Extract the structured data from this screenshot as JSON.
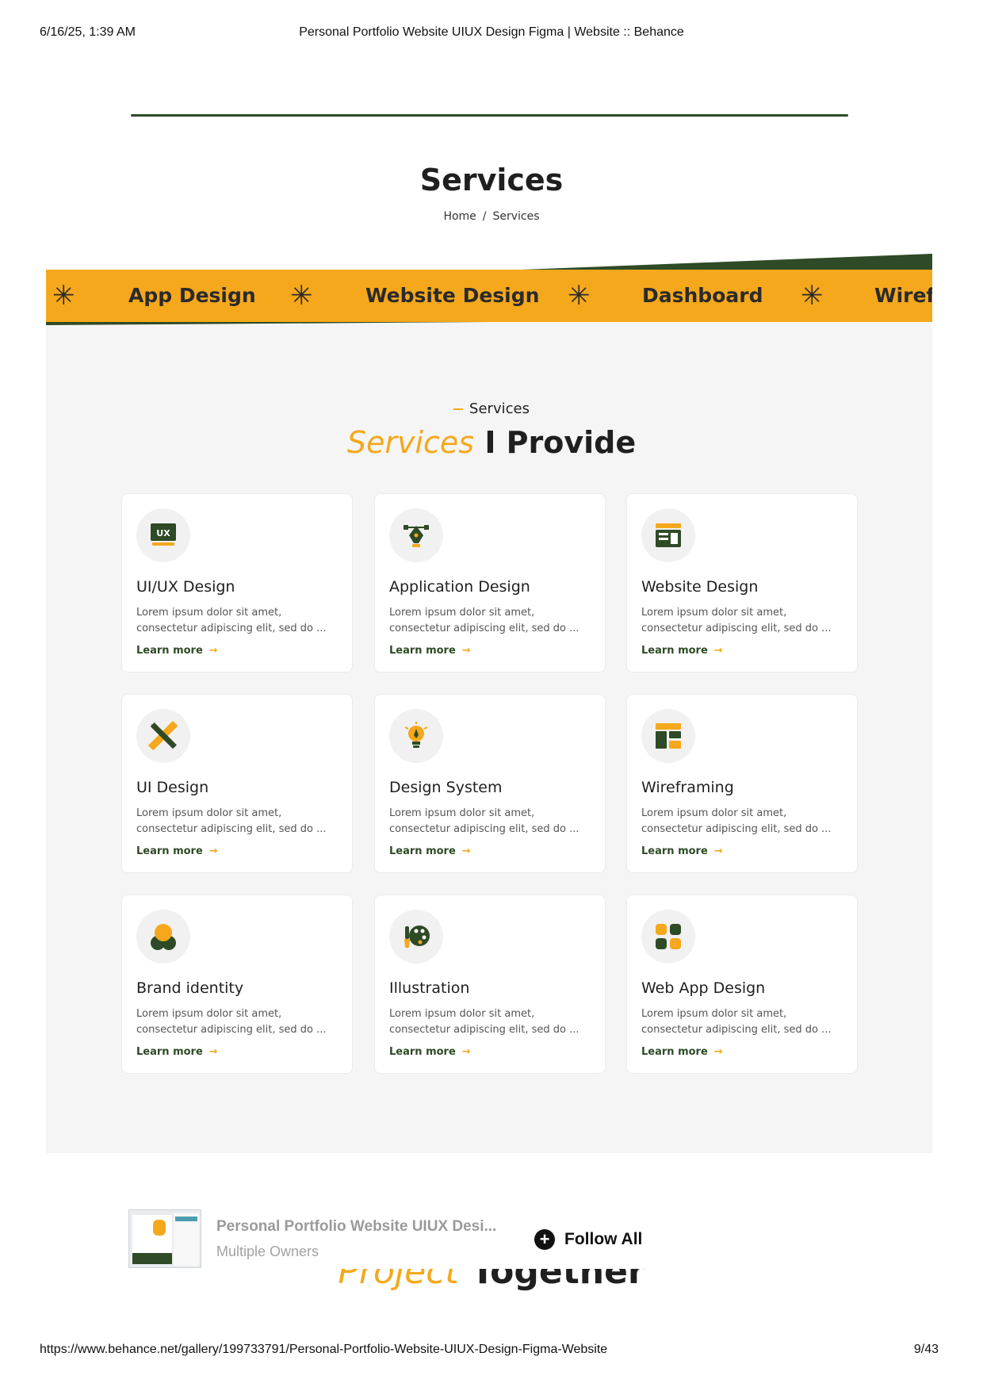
{
  "print_header": {
    "datetime": "6/16/25, 1:39 AM",
    "title": "Personal Portfolio Website UIUX Design Figma | Website :: Behance"
  },
  "hero": {
    "title": "Services",
    "breadcrumb": {
      "home": "Home",
      "separator": "/",
      "current": "Services"
    }
  },
  "ticker": {
    "items": [
      "App Design",
      "Website Design",
      "Dashboard",
      "Wirefr"
    ]
  },
  "section": {
    "eyebrow": "Services",
    "title_accent": "Services",
    "title_rest": "I Provide"
  },
  "cards": [
    {
      "title": "UI/UX Design",
      "desc": "Lorem ipsum dolor sit amet, consectetur adipiscing elit, sed do ...",
      "link": "Learn more",
      "icon": "ux-monitor-icon"
    },
    {
      "title": "Application Design",
      "desc": "Lorem ipsum dolor sit amet, consectetur adipiscing elit, sed do ...",
      "link": "Learn more",
      "icon": "pen-tool-icon"
    },
    {
      "title": "Website Design",
      "desc": "Lorem ipsum dolor sit amet, consectetur adipiscing elit, sed do ...",
      "link": "Learn more",
      "icon": "browser-layout-icon"
    },
    {
      "title": "UI Design",
      "desc": "Lorem ipsum dolor sit amet, consectetur adipiscing elit, sed do ...",
      "link": "Learn more",
      "icon": "ruler-pencil-icon"
    },
    {
      "title": "Design System",
      "desc": "Lorem ipsum dolor sit amet, consectetur adipiscing elit, sed do ...",
      "link": "Learn more",
      "icon": "lightbulb-pen-icon"
    },
    {
      "title": "Wireframing",
      "desc": "Lorem ipsum dolor sit amet, consectetur adipiscing elit, sed do ...",
      "link": "Learn more",
      "icon": "wireframe-layout-icon"
    },
    {
      "title": "Brand identity",
      "desc": "Lorem ipsum dolor sit amet, consectetur adipiscing elit, sed do ...",
      "link": "Learn more",
      "icon": "brand-shapes-icon"
    },
    {
      "title": "Illustration",
      "desc": "Lorem ipsum dolor sit amet, consectetur adipiscing elit, sed do ...",
      "link": "Learn more",
      "icon": "palette-brush-icon"
    },
    {
      "title": "Web App Design",
      "desc": "Lorem ipsum dolor sit amet, consectetur adipiscing elit, sed do ...",
      "link": "Learn more",
      "icon": "app-grid-icon"
    }
  ],
  "behind_text": {
    "accent": "Project",
    "rest": "Together"
  },
  "follow_bar": {
    "project_title": "Personal Portfolio Website UIUX Desi...",
    "owners": "Multiple Owners",
    "follow_label": "Follow All"
  },
  "print_footer": {
    "url": "https://www.behance.net/gallery/199733791/Personal-Portfolio-Website-UIUX-Design-Figma-Website",
    "page": "9/43"
  },
  "colors": {
    "accent": "#f5a81b",
    "dark_green": "#2e4a26",
    "panel_bg": "#f5f5f5"
  }
}
